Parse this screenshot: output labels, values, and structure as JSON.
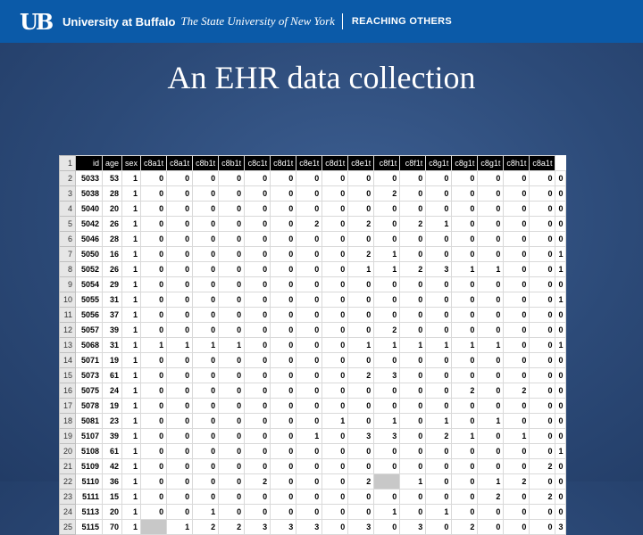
{
  "banner": {
    "logo": "UB",
    "university": "University at Buffalo",
    "tagline": "The State University of New York",
    "motto": "REACHING OTHERS"
  },
  "title": "An EHR data collection",
  "sheet": {
    "columns": [
      "id",
      "age",
      "sex",
      "c8a1t",
      "c8a1t",
      "c8b1t",
      "c8b1t",
      "c8c1t",
      "c8d1t",
      "c8e1t",
      "c8d1t",
      "c8e1t",
      "c8f1t",
      "c8f1t",
      "c8g1t",
      "c8g1t",
      "c8g1t",
      "c8h1t",
      "c8a1t"
    ],
    "rows": [
      {
        "n": "2",
        "cells": [
          "5033",
          "53",
          "1",
          "0",
          "0",
          "0",
          "0",
          "0",
          "0",
          "0",
          "0",
          "0",
          "0",
          "0",
          "0",
          "0",
          "0",
          "0",
          "0",
          "0"
        ]
      },
      {
        "n": "3",
        "cells": [
          "5038",
          "28",
          "1",
          "0",
          "0",
          "0",
          "0",
          "0",
          "0",
          "0",
          "0",
          "0",
          "2",
          "0",
          "0",
          "0",
          "0",
          "0",
          "0",
          "0"
        ]
      },
      {
        "n": "4",
        "cells": [
          "5040",
          "20",
          "1",
          "0",
          "0",
          "0",
          "0",
          "0",
          "0",
          "0",
          "0",
          "0",
          "0",
          "0",
          "0",
          "0",
          "0",
          "0",
          "0",
          "0"
        ]
      },
      {
        "n": "5",
        "cells": [
          "5042",
          "26",
          "1",
          "0",
          "0",
          "0",
          "0",
          "0",
          "0",
          "2",
          "0",
          "2",
          "0",
          "2",
          "1",
          "0",
          "0",
          "0",
          "0",
          "0"
        ]
      },
      {
        "n": "6",
        "cells": [
          "5046",
          "28",
          "1",
          "0",
          "0",
          "0",
          "0",
          "0",
          "0",
          "0",
          "0",
          "0",
          "0",
          "0",
          "0",
          "0",
          "0",
          "0",
          "0",
          "0"
        ]
      },
      {
        "n": "7",
        "cells": [
          "5050",
          "16",
          "1",
          "0",
          "0",
          "0",
          "0",
          "0",
          "0",
          "0",
          "0",
          "2",
          "1",
          "0",
          "0",
          "0",
          "0",
          "0",
          "0",
          "1"
        ]
      },
      {
        "n": "8",
        "cells": [
          "5052",
          "26",
          "1",
          "0",
          "0",
          "0",
          "0",
          "0",
          "0",
          "0",
          "0",
          "1",
          "1",
          "2",
          "3",
          "1",
          "1",
          "0",
          "0",
          "1"
        ]
      },
      {
        "n": "9",
        "cells": [
          "5054",
          "29",
          "1",
          "0",
          "0",
          "0",
          "0",
          "0",
          "0",
          "0",
          "0",
          "0",
          "0",
          "0",
          "0",
          "0",
          "0",
          "0",
          "0",
          "0"
        ]
      },
      {
        "n": "10",
        "cells": [
          "5055",
          "31",
          "1",
          "0",
          "0",
          "0",
          "0",
          "0",
          "0",
          "0",
          "0",
          "0",
          "0",
          "0",
          "0",
          "0",
          "0",
          "0",
          "0",
          "1"
        ]
      },
      {
        "n": "11",
        "cells": [
          "5056",
          "37",
          "1",
          "0",
          "0",
          "0",
          "0",
          "0",
          "0",
          "0",
          "0",
          "0",
          "0",
          "0",
          "0",
          "0",
          "0",
          "0",
          "0",
          "0"
        ]
      },
      {
        "n": "12",
        "cells": [
          "5057",
          "39",
          "1",
          "0",
          "0",
          "0",
          "0",
          "0",
          "0",
          "0",
          "0",
          "0",
          "2",
          "0",
          "0",
          "0",
          "0",
          "0",
          "0",
          "0"
        ]
      },
      {
        "n": "13",
        "cells": [
          "5068",
          "31",
          "1",
          "1",
          "1",
          "1",
          "1",
          "0",
          "0",
          "0",
          "0",
          "1",
          "1",
          "1",
          "1",
          "1",
          "1",
          "0",
          "0",
          "1"
        ]
      },
      {
        "n": "14",
        "cells": [
          "5071",
          "19",
          "1",
          "0",
          "0",
          "0",
          "0",
          "0",
          "0",
          "0",
          "0",
          "0",
          "0",
          "0",
          "0",
          "0",
          "0",
          "0",
          "0",
          "0"
        ]
      },
      {
        "n": "15",
        "cells": [
          "5073",
          "61",
          "1",
          "0",
          "0",
          "0",
          "0",
          "0",
          "0",
          "0",
          "0",
          "2",
          "3",
          "0",
          "0",
          "0",
          "0",
          "0",
          "0",
          "0"
        ]
      },
      {
        "n": "16",
        "cells": [
          "5075",
          "24",
          "1",
          "0",
          "0",
          "0",
          "0",
          "0",
          "0",
          "0",
          "0",
          "0",
          "0",
          "0",
          "0",
          "2",
          "0",
          "2",
          "0",
          "0"
        ]
      },
      {
        "n": "17",
        "cells": [
          "5078",
          "19",
          "1",
          "0",
          "0",
          "0",
          "0",
          "0",
          "0",
          "0",
          "0",
          "0",
          "0",
          "0",
          "0",
          "0",
          "0",
          "0",
          "0",
          "0"
        ]
      },
      {
        "n": "18",
        "cells": [
          "5081",
          "23",
          "1",
          "0",
          "0",
          "0",
          "0",
          "0",
          "0",
          "0",
          "1",
          "0",
          "1",
          "0",
          "1",
          "0",
          "1",
          "0",
          "0",
          "0"
        ]
      },
      {
        "n": "19",
        "cells": [
          "5107",
          "39",
          "1",
          "0",
          "0",
          "0",
          "0",
          "0",
          "0",
          "1",
          "0",
          "3",
          "3",
          "0",
          "2",
          "1",
          "0",
          "1",
          "0",
          "0"
        ]
      },
      {
        "n": "20",
        "cells": [
          "5108",
          "61",
          "1",
          "0",
          "0",
          "0",
          "0",
          "0",
          "0",
          "0",
          "0",
          "0",
          "0",
          "0",
          "0",
          "0",
          "0",
          "0",
          "0",
          "1"
        ]
      },
      {
        "n": "21",
        "cells": [
          "5109",
          "42",
          "1",
          "0",
          "0",
          "0",
          "0",
          "0",
          "0",
          "0",
          "0",
          "0",
          "0",
          "0",
          "0",
          "0",
          "0",
          "0",
          "2",
          "0"
        ]
      },
      {
        "n": "22",
        "cells": [
          "5110",
          "36",
          "1",
          "0",
          "0",
          "0",
          "0",
          "2",
          "0",
          "0",
          "0",
          "2",
          "",
          "1",
          "0",
          "0",
          "1",
          "2",
          "0",
          "0"
        ]
      },
      {
        "n": "23",
        "cells": [
          "5111",
          "15",
          "1",
          "0",
          "0",
          "0",
          "0",
          "0",
          "0",
          "0",
          "0",
          "0",
          "0",
          "0",
          "0",
          "0",
          "2",
          "0",
          "2",
          "0"
        ]
      },
      {
        "n": "24",
        "cells": [
          "5113",
          "20",
          "1",
          "0",
          "0",
          "1",
          "0",
          "0",
          "0",
          "0",
          "0",
          "0",
          "1",
          "0",
          "1",
          "0",
          "0",
          "0",
          "0",
          "0"
        ]
      },
      {
        "n": "25",
        "cells": [
          "5115",
          "70",
          "1",
          "",
          "1",
          "2",
          "2",
          "3",
          "3",
          "3",
          "0",
          "3",
          "0",
          "3",
          "0",
          "2",
          "0",
          "0",
          "0",
          "3"
        ]
      }
    ]
  },
  "colors": {
    "banner": "#0b5aa8",
    "background": "#2c4a78",
    "header_row": "#000000",
    "empty_cell": "#c8c8c8"
  }
}
